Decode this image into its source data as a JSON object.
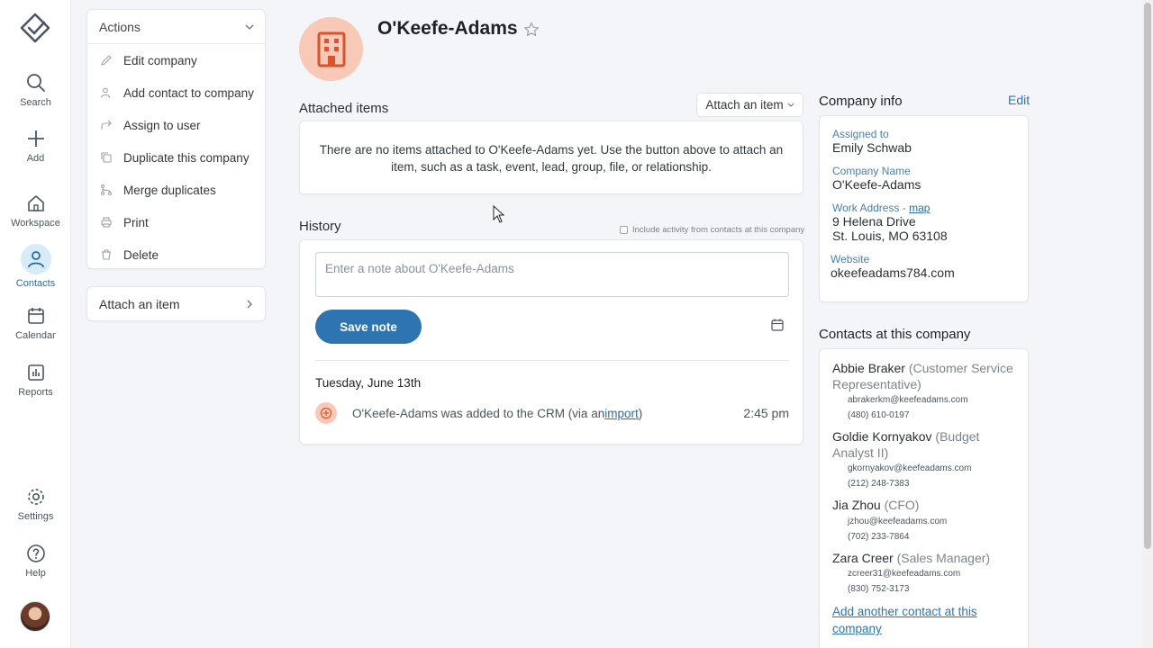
{
  "nav": {
    "items": [
      {
        "label": "Search",
        "icon": "search-icon"
      },
      {
        "label": "Add",
        "icon": "plus-icon"
      },
      {
        "label": "Workspace",
        "icon": "home-icon"
      },
      {
        "label": "Contacts",
        "icon": "person-icon",
        "active": true
      },
      {
        "label": "Calendar",
        "icon": "calendar-icon"
      },
      {
        "label": "Reports",
        "icon": "chart-icon"
      },
      {
        "label": "Settings",
        "icon": "gear-icon"
      },
      {
        "label": "Help",
        "icon": "help-icon"
      }
    ]
  },
  "actions": {
    "title": "Actions",
    "items": [
      {
        "label": "Edit company",
        "icon": "pencil-icon"
      },
      {
        "label": "Add contact to company",
        "icon": "add-person-icon"
      },
      {
        "label": "Assign to user",
        "icon": "share-arrow-icon"
      },
      {
        "label": "Duplicate this company",
        "icon": "copy-icon"
      },
      {
        "label": "Merge duplicates",
        "icon": "merge-icon"
      },
      {
        "label": "Print",
        "icon": "printer-icon"
      },
      {
        "label": "Delete",
        "icon": "trash-icon"
      }
    ],
    "attach_label": "Attach an item"
  },
  "company": {
    "name": "O'Keefe-Adams"
  },
  "attached": {
    "title": "Attached items",
    "button": "Attach an item",
    "empty_text": "There are no items attached to O'Keefe-Adams yet. Use the button above to attach an item, such as a task, event, lead, group, file, or relationship."
  },
  "history": {
    "title": "History",
    "include_label": "Include activity from contacts at this company",
    "note_placeholder": "Enter a note about O'Keefe-Adams",
    "save_label": "Save note",
    "date": "Tuesday, June 13th",
    "event_text": "O'Keefe-Adams was added to the CRM (via an ",
    "event_link": "import",
    "event_close": ")",
    "event_time": "2:45 pm"
  },
  "company_info": {
    "title": "Company info",
    "edit": "Edit",
    "assigned_label": "Assigned to",
    "assigned": "Emily Schwab",
    "name_label": "Company Name",
    "name": "O'Keefe-Adams",
    "address_label": "Work Address - ",
    "map_link": "map",
    "address_line1": "9 Helena Drive",
    "address_line2": "St. Louis, MO 63108",
    "website_label": "Website",
    "website": "okeefeadams784.com"
  },
  "contacts": {
    "title": "Contacts at this company",
    "items": [
      {
        "name": "Abbie Braker",
        "role": "(Customer Service Representative)",
        "email": "abrakerkm@keefeadams.com",
        "phone": "(480) 610-0197"
      },
      {
        "name": "Goldie Kornyakov",
        "role": "(Budget Analyst II)",
        "email": "gkornyakov@keefeadams.com",
        "phone": "(212) 248-7383"
      },
      {
        "name": "Jia Zhou",
        "role": "(CFO)",
        "email": "jzhou@keefeadams.com",
        "phone": "(702) 233-7864"
      },
      {
        "name": "Zara Creer",
        "role": "(Sales Manager)",
        "email": "zcreer31@keefeadams.com",
        "phone": "(830) 752-3173"
      }
    ],
    "add_link": "Add another contact at this company"
  },
  "colors": {
    "accent": "#2e74b0",
    "company_avatar_bg": "#f7c9b6",
    "company_icon": "#d9542c"
  }
}
